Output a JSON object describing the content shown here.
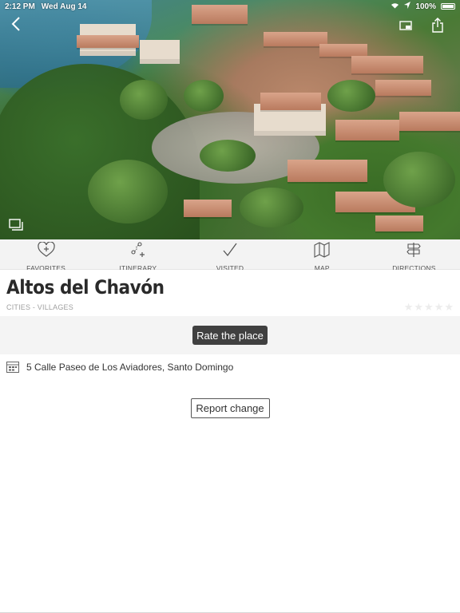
{
  "status_bar": {
    "time": "2:12 PM",
    "date": "Wed Aug 14",
    "battery": "100%",
    "icons": [
      "wifi-icon",
      "location-icon",
      "battery-icon"
    ]
  },
  "hero": {
    "buttons": [
      "back-icon",
      "screen-icon",
      "share-icon",
      "gallery-icon"
    ]
  },
  "actions": [
    {
      "label": "FAVORITES",
      "icon": "heart-plus-icon"
    },
    {
      "label": "ITINERARY",
      "icon": "itinerary-icon"
    },
    {
      "label": "VISITED",
      "icon": "checkmark-icon"
    },
    {
      "label": "MAP",
      "icon": "map-icon"
    },
    {
      "label": "DIRECTIONS",
      "icon": "signpost-icon"
    }
  ],
  "place": {
    "title": "Altos del Chavón",
    "category": "CITIES - VILLAGES",
    "rating": 0,
    "max_rating": 5
  },
  "rate": {
    "label": "Rate the place"
  },
  "address": {
    "text": "5 Calle Paseo de Los Aviadores, Santo Domingo",
    "icon": "address-icon"
  },
  "report": {
    "label": "Report change"
  },
  "colors": {
    "action_bar_bg": "#f3f3f3",
    "rate_button_bg": "#404040",
    "star_inactive": "#ececec",
    "title_text": "#2a2a2a"
  }
}
